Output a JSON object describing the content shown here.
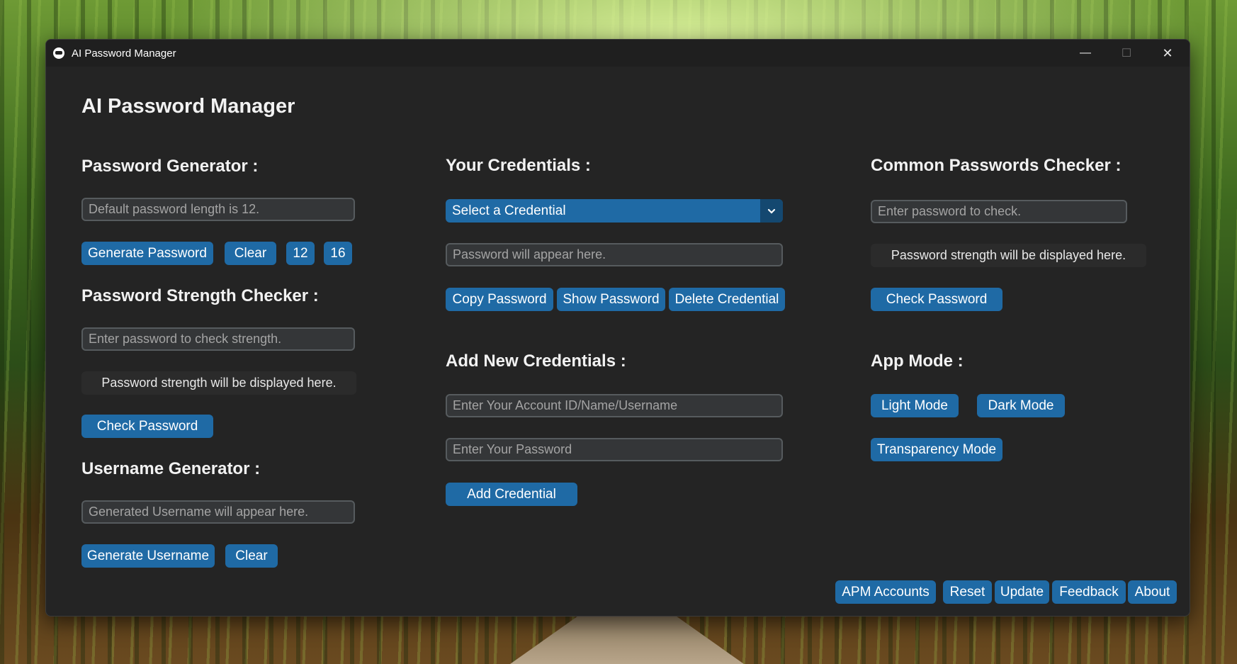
{
  "window": {
    "title": "AI Password Manager",
    "controls": {
      "minimize": "—",
      "maximize": "☐",
      "close": "✕"
    }
  },
  "app": {
    "title": "AI Password Manager"
  },
  "password_generator": {
    "title": "Password Generator :",
    "placeholder": "Default password length is 12.",
    "generate_label": "Generate Password",
    "clear_label": "Clear",
    "length_12": "12",
    "length_16": "16"
  },
  "strength_checker": {
    "title": "Password Strength Checker :",
    "placeholder": "Enter password to check strength.",
    "result_text": "Password strength will be displayed here.",
    "check_label": "Check Password"
  },
  "username_generator": {
    "title": "Username Generator :",
    "placeholder": "Generated Username will appear here.",
    "generate_label": "Generate Username",
    "clear_label": "Clear"
  },
  "credentials": {
    "title": "Your Credentials :",
    "select_value": "Select a Credential",
    "password_placeholder": "Password will appear here.",
    "copy_label": "Copy Password",
    "show_label": "Show Password",
    "delete_label": "Delete Credential"
  },
  "add_credentials": {
    "title": "Add New Credentials :",
    "account_placeholder": "Enter Your Account ID/Name/Username",
    "password_placeholder": "Enter Your Password",
    "add_label": "Add Credential"
  },
  "common_checker": {
    "title": "Common Passwords Checker :",
    "placeholder": "Enter password to check.",
    "result_text": "Password strength will be displayed here.",
    "check_label": "Check Password"
  },
  "app_mode": {
    "title": "App Mode :",
    "light_label": "Light Mode",
    "dark_label": "Dark Mode",
    "transparency_label": "Transparency Mode"
  },
  "footer": {
    "apm_accounts": "APM Accounts",
    "reset": "Reset",
    "update": "Update",
    "feedback": "Feedback",
    "about": "About"
  },
  "colors": {
    "window_bg": "#242424",
    "accent": "#1f6aa5",
    "field_bg": "#343638",
    "text": "#f2f2f2"
  }
}
